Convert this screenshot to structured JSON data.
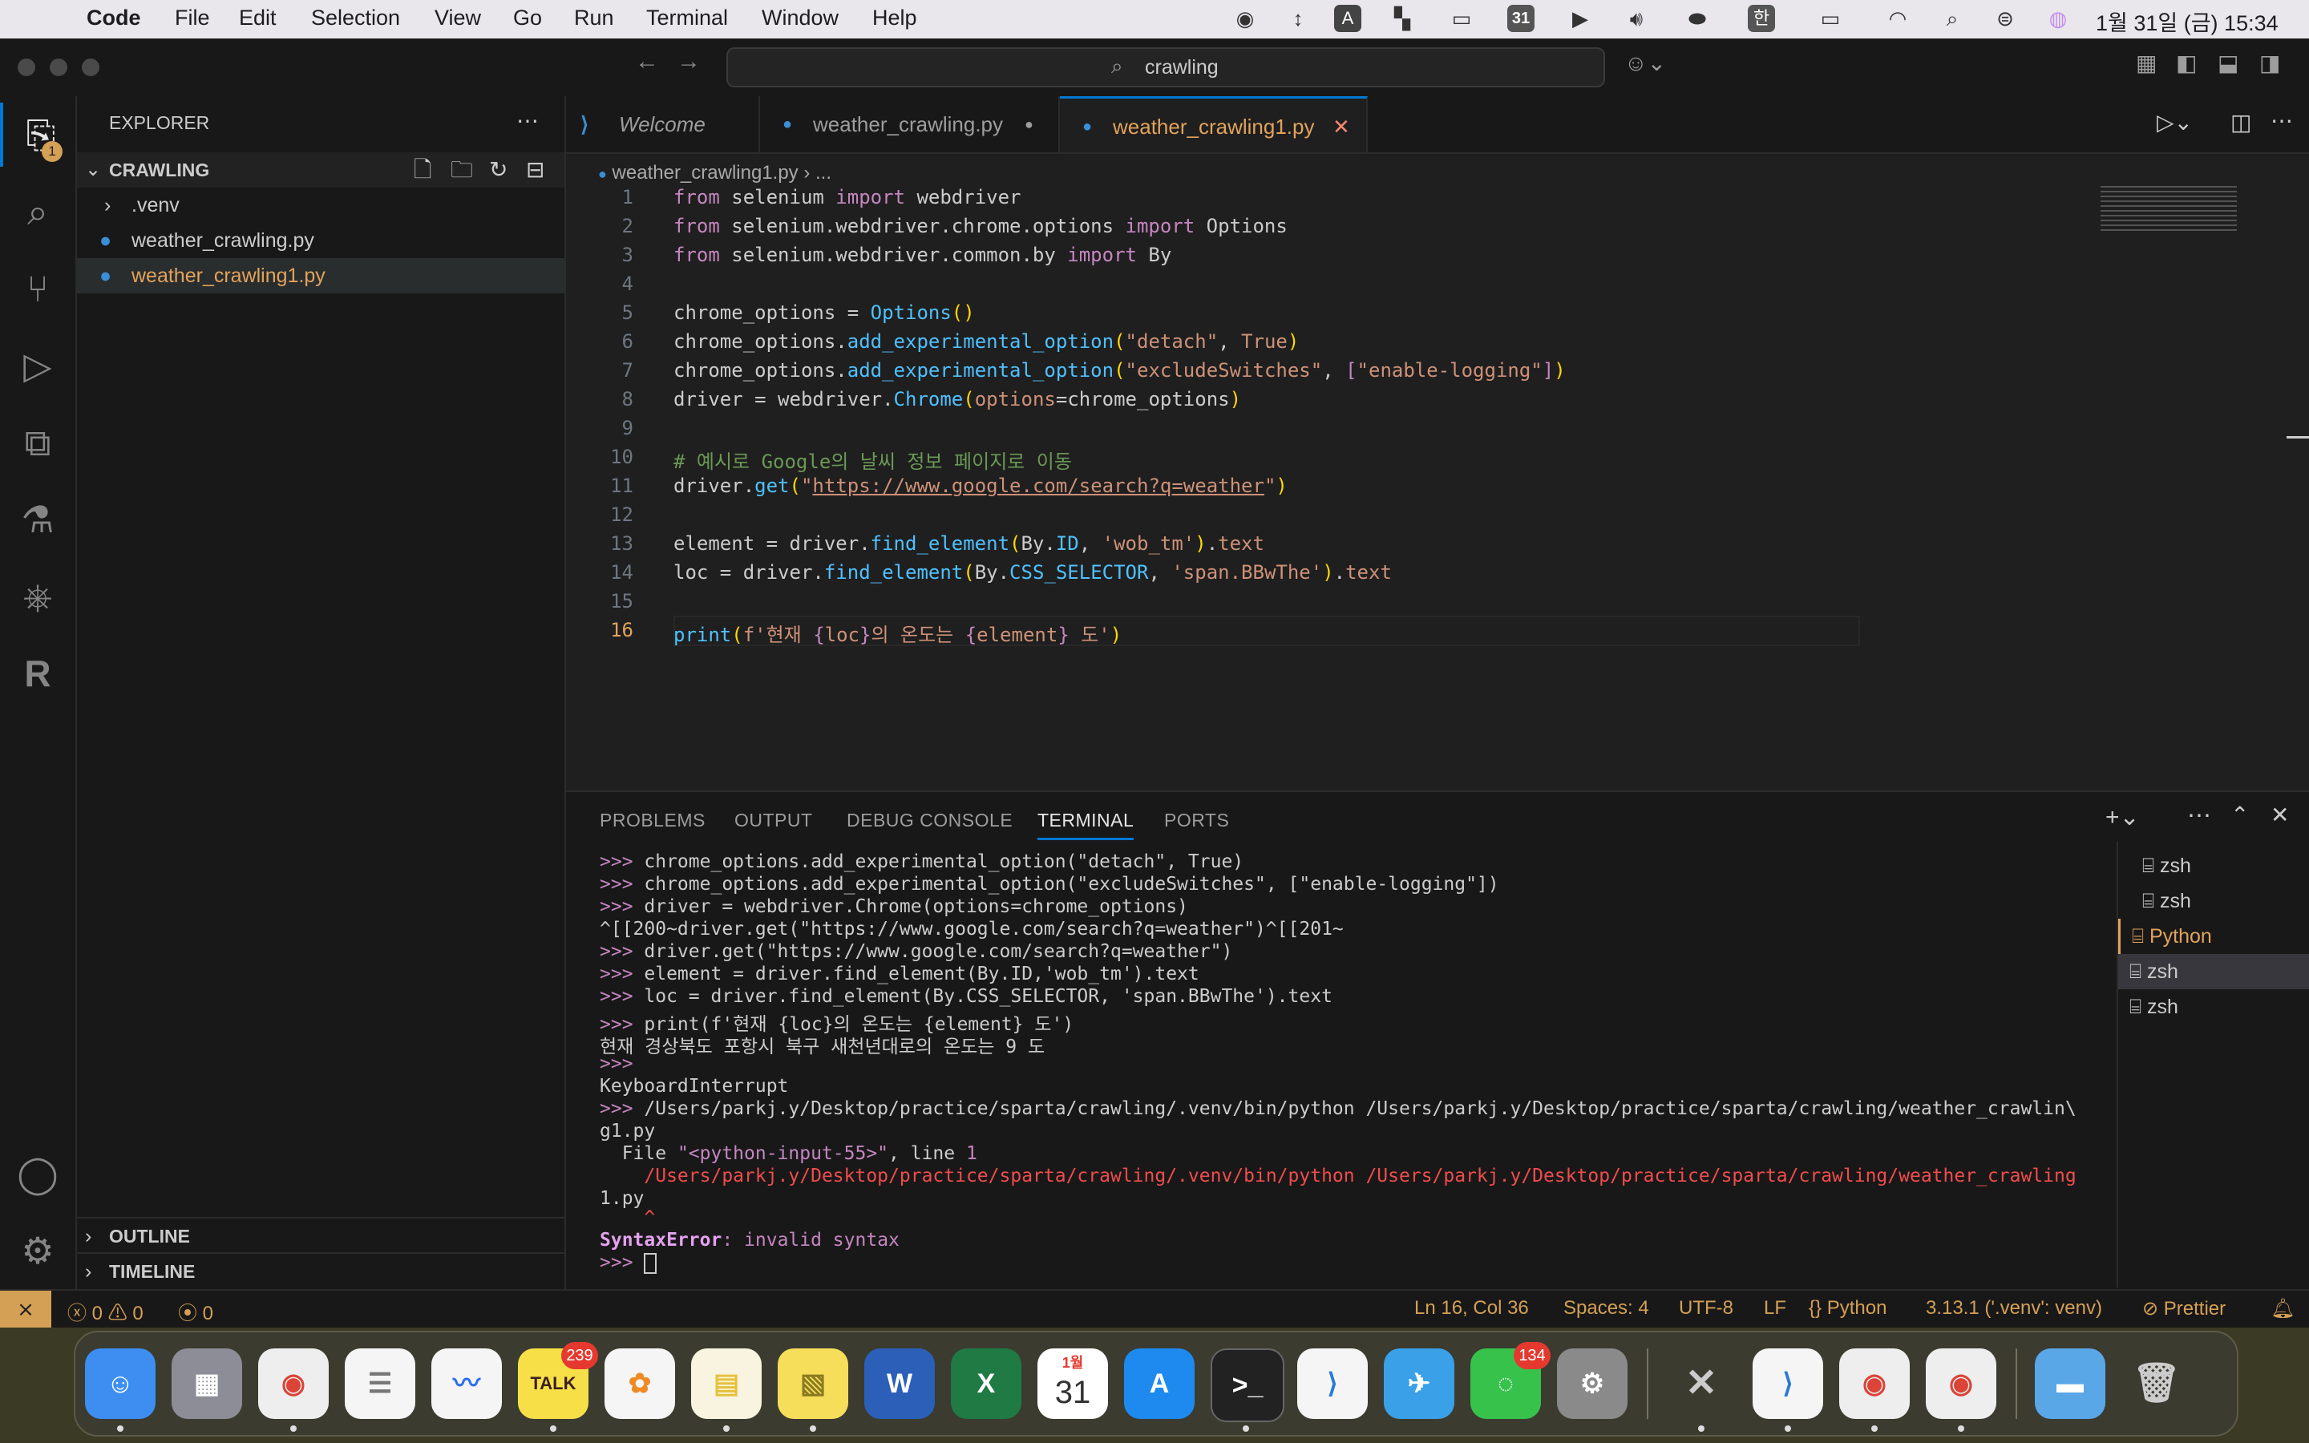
{
  "menubar": {
    "app": "Code",
    "items": [
      "File",
      "Edit",
      "Selection",
      "View",
      "Go",
      "Run",
      "Terminal",
      "Window",
      "Help"
    ],
    "calendar_day": "31",
    "input_method": "한",
    "clock": "1월 31일 (금) 15:34"
  },
  "titlebar": {
    "search": "crawling"
  },
  "activity": {
    "explorer_badge": "1"
  },
  "sidebar": {
    "title": "EXPLORER",
    "folder": "CRAWLING",
    "items": [
      ".venv",
      "weather_crawling.py",
      "weather_crawling1.py"
    ],
    "outline": "OUTLINE",
    "timeline": "TIMELINE"
  },
  "tabs": [
    {
      "label": "Welcome"
    },
    {
      "label": "weather_crawling.py"
    },
    {
      "label": "weather_crawling1.py"
    }
  ],
  "breadcrumb": {
    "file": "weather_crawling1.py",
    "more": "..."
  },
  "code": {
    "line_numbers": [
      "1",
      "2",
      "3",
      "4",
      "5",
      "6",
      "7",
      "8",
      "9",
      "10",
      "11",
      "12",
      "13",
      "14",
      "15",
      "16"
    ],
    "t": {
      "from": "from",
      "import": "import",
      "selenium": " selenium ",
      "webdriver": " webdriver",
      "l2mod": " selenium.webdriver.chrome.options ",
      "Options": " Options",
      "l3mod": " selenium.webdriver.common.by ",
      "By": " By",
      "chrome_options_eq": "chrome_options = ",
      "Options_call": "Options",
      "parens": "()",
      "chrome_options_dot": "chrome_options.",
      "add_exp": "add_experimental_option",
      "lp": "(",
      "rp": ")",
      "comma": ", ",
      "detach": "\"detach\"",
      "True": "True",
      "exclude": "\"excludeSwitches\"",
      "lb": "[",
      "rb": "]",
      "enable": "\"enable-logging\"",
      "driver_eq": "driver = webdriver.",
      "Chrome": "Chrome",
      "options": "options",
      "eq": "=",
      "chrome_options": "chrome_options",
      "comment": "# 예시로 Google의 날씨 정보 페이지로 이동",
      "driver_dot": "driver.",
      "get": "get",
      "url_q": "\"",
      "url": "https://www.google.com/search?q=weather",
      "element_eq": "element = driver.",
      "find_element": "find_element",
      "By_dot": "By.",
      "ID": "ID",
      "wob": "'wob_tm'",
      "dot_text": ".",
      "text": "text",
      "loc_eq": "loc = driver.",
      "CSS": "CSS_SELECTOR",
      "span": "'span.BBwThe'",
      "print": "print",
      "fstr1": "f'현재 ",
      "lbrace": "{",
      "loc": "loc",
      "rbrace": "}",
      "fstr2": "의 온도는 ",
      "element": "element",
      "fstr3": " 도'"
    }
  },
  "panel": {
    "tabs": [
      "PROBLEMS",
      "OUTPUT",
      "DEBUG CONSOLE",
      "TERMINAL",
      "PORTS"
    ],
    "prompt": ">>>",
    "lines": [
      " chrome_options.add_experimental_option(\"detach\", True)",
      " chrome_options.add_experimental_option(\"excludeSwitches\", [\"enable-logging\"])",
      " driver = webdriver.Chrome(options=chrome_options)",
      "^[[200~driver.get(\"https://www.google.com/search?q=weather\")^[[201~",
      " driver.get(\"https://www.google.com/search?q=weather\")",
      " element = driver.find_element(By.ID,'wob_tm').text",
      " loc = driver.find_element(By.CSS_SELECTOR, 'span.BBwThe').text",
      " print(f'현재 {loc}의 온도는 {element} 도')",
      "현재 경상북도 포항시 북구 새천년대로의 온도는 9 도",
      "KeyboardInterrupt",
      " /Users/parkj.y/Desktop/practice/sparta/crawling/.venv/bin/python /Users/parkj.y/Desktop/practice/sparta/crawling/weather_crawlin\\",
      "g1.py",
      "  File ",
      "\"<python-input-55>\"",
      ", line ",
      "1",
      "    /Users/parkj.y/Desktop/practice/sparta/crawling/.venv/bin/python /Users/parkj.y/Desktop/practice/sparta/crawling/weather_crawling",
      "1.py",
      "    ^",
      "SyntaxError",
      ": invalid syntax"
    ],
    "terminals": [
      "zsh",
      "zsh",
      "Python",
      "zsh",
      "zsh"
    ]
  },
  "status": {
    "errors": "0",
    "warnings": "0",
    "ports": "0",
    "position": "Ln 16, Col 36",
    "spaces": "Spaces: 4",
    "encoding": "UTF-8",
    "eol": "LF",
    "language": "Python",
    "interpreter": "3.13.1 ('.venv': venv)",
    "prettier": "Prettier"
  },
  "dock": {
    "badges": {
      "talk": "239",
      "messages": "134"
    },
    "labels": {
      "talk": "TALK",
      "calendar_month": "1월",
      "calendar_day": "31"
    }
  }
}
